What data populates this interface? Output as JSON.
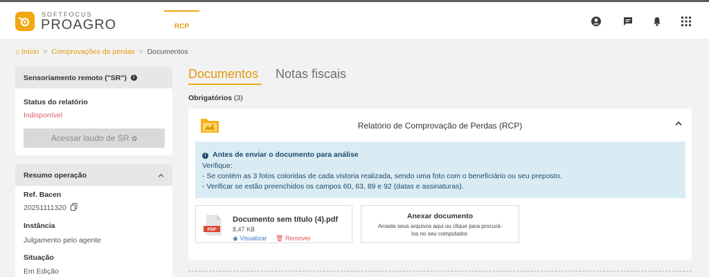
{
  "brand": {
    "small": "SOFTFOCUS",
    "big": "PROAGRO",
    "accent": "#f3a712"
  },
  "nav": {
    "active": "RCP"
  },
  "header_icons": [
    "user-circle-icon",
    "chat-icon",
    "bell-icon",
    "apps-grid-icon"
  ],
  "breadcrumb": {
    "home": "Início",
    "sep": ">",
    "link2": "Comprovações de perdas",
    "current": "Documentos"
  },
  "sr_card": {
    "title": "Sensoriamento remoto (\"SR\")",
    "status_label": "Status do relatório",
    "status_value": "Indisponível",
    "button": "Acessar laudo de SR"
  },
  "summary_card": {
    "title": "Resumo operação",
    "ref_label": "Ref. Bacen",
    "ref_value": "20251111320",
    "instancia_label": "Instância",
    "instancia_value": "Julgamento pelo agente",
    "situacao_label": "Situação",
    "situacao_value": "Em Edição"
  },
  "tabs": {
    "docs": "Documentos",
    "notas": "Notas fiscais"
  },
  "required": {
    "label": "Obrigatórios",
    "count": "(3)"
  },
  "panel": {
    "title": "Relatório de Comprovação de Perdas (RCP)",
    "alert": {
      "title": "Antes de enviar o documento para análise",
      "l1": "Verifique:",
      "l2": "- Se contém as 3 fotos coloridas de cada vistoria realizada, sendo uma foto com o beneficiário ou seu preposto.",
      "l3": "- Verificar se estão preenchidos os campos 60, 63, 89 e 92 (datas e assinaturas)."
    },
    "file": {
      "name": "Documento sem título (4).pdf",
      "size": "8,47 KB",
      "view": "Visualizar",
      "remove": "Remover",
      "badge": "PDF"
    },
    "attach": {
      "title": "Anexar documento",
      "desc": "Arraste seus arquivos aqui ou clique para procurá-los no seu computador."
    }
  }
}
